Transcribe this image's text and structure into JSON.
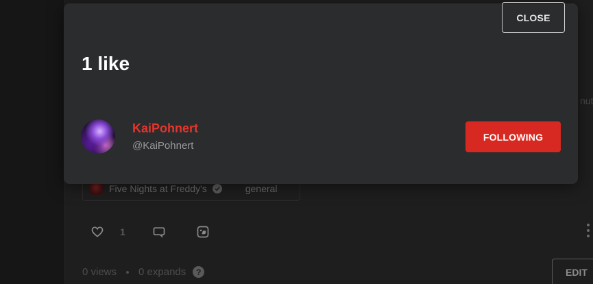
{
  "background": {
    "partial_text": "nut",
    "community_tag": "Five Nights at Freddy's",
    "category_tag": "general",
    "like_count": "1",
    "stats": {
      "views": "0 views",
      "expands": "0 expands"
    },
    "help_symbol": "?",
    "edit_label": "EDIT"
  },
  "modal": {
    "close_label": "CLOSE",
    "title": "1 like",
    "user": {
      "name": "KaiPohnert",
      "handle": "@KaiPohnert",
      "follow_label": "FOLLOWING"
    }
  },
  "colors": {
    "accent": "#d72921",
    "username": "#e5352b",
    "modal_bg": "#2a2c2e"
  },
  "icons": [
    "heart-icon",
    "comment-icon",
    "reblog-icon",
    "verified-icon",
    "help-icon",
    "more-icon"
  ]
}
